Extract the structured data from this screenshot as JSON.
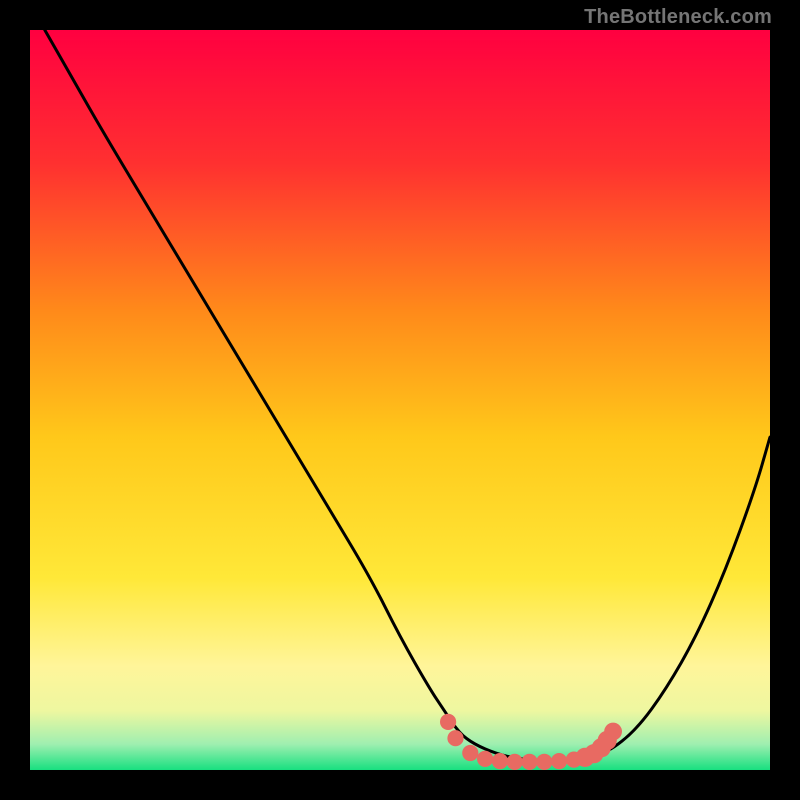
{
  "attribution": "TheBottleneck.com",
  "colors": {
    "page_bg": "#000000",
    "curve": "#000000",
    "marker": "#e86a62",
    "gradient": [
      {
        "offset": 0.0,
        "hex": "#ff0040"
      },
      {
        "offset": 0.18,
        "hex": "#ff3030"
      },
      {
        "offset": 0.38,
        "hex": "#ff8a1a"
      },
      {
        "offset": 0.55,
        "hex": "#ffc81a"
      },
      {
        "offset": 0.74,
        "hex": "#ffe838"
      },
      {
        "offset": 0.86,
        "hex": "#fff59a"
      },
      {
        "offset": 0.92,
        "hex": "#eef7a0"
      },
      {
        "offset": 0.965,
        "hex": "#9fefb0"
      },
      {
        "offset": 1.0,
        "hex": "#18e080"
      }
    ]
  },
  "chart_data": {
    "type": "line",
    "title": "",
    "xlabel": "",
    "ylabel": "",
    "xlim": [
      0,
      100
    ],
    "ylim": [
      0,
      100
    ],
    "grid": false,
    "series": [
      {
        "name": "bottleneck_curve",
        "x": [
          2,
          6,
          10,
          16,
          22,
          28,
          34,
          40,
          46,
          50,
          54,
          56,
          58,
          60,
          63,
          66,
          70,
          74,
          78,
          82,
          86,
          90,
          94,
          98,
          100
        ],
        "y": [
          100,
          93,
          86,
          76,
          66,
          56,
          46,
          36,
          26,
          18,
          11,
          8,
          5,
          3.5,
          2.2,
          1.5,
          1.2,
          1.3,
          2.3,
          5.5,
          11,
          18,
          27,
          38,
          45
        ]
      }
    ],
    "markers": {
      "name": "valley_highlight",
      "color": "#e86a62",
      "points": [
        {
          "x": 56.5,
          "y": 6.5,
          "r": 1.1
        },
        {
          "x": 57.5,
          "y": 4.3,
          "r": 1.1
        },
        {
          "x": 59.5,
          "y": 2.3,
          "r": 1.1
        },
        {
          "x": 61.5,
          "y": 1.5,
          "r": 1.1
        },
        {
          "x": 63.5,
          "y": 1.2,
          "r": 1.1
        },
        {
          "x": 65.5,
          "y": 1.1,
          "r": 1.1
        },
        {
          "x": 67.5,
          "y": 1.1,
          "r": 1.1
        },
        {
          "x": 69.5,
          "y": 1.1,
          "r": 1.1
        },
        {
          "x": 71.5,
          "y": 1.2,
          "r": 1.1
        },
        {
          "x": 73.5,
          "y": 1.4,
          "r": 1.1
        },
        {
          "x": 75.0,
          "y": 1.7,
          "r": 1.3
        },
        {
          "x": 76.2,
          "y": 2.2,
          "r": 1.3
        },
        {
          "x": 77.2,
          "y": 3.0,
          "r": 1.3
        },
        {
          "x": 78.0,
          "y": 4.0,
          "r": 1.3
        },
        {
          "x": 78.8,
          "y": 5.2,
          "r": 1.2
        }
      ]
    }
  }
}
